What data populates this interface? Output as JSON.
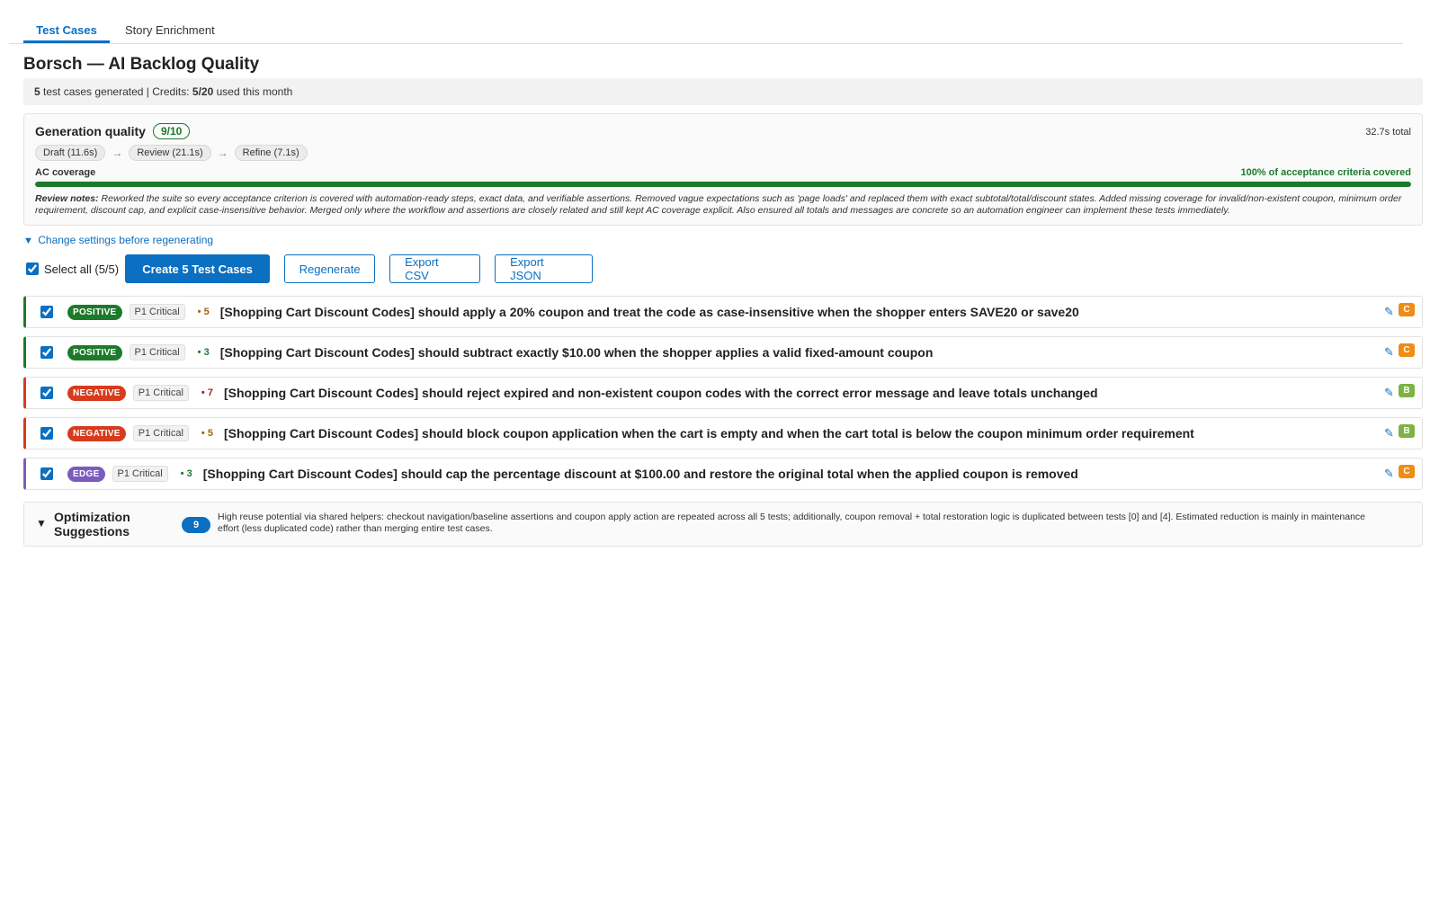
{
  "tabs": [
    {
      "label": "Test Cases",
      "active": true
    },
    {
      "label": "Story Enrichment",
      "active": false
    }
  ],
  "title": "Borsch — AI Backlog Quality",
  "summary": {
    "generated_count": "5",
    "generated_text": "test cases generated | Credits:",
    "credits": "5/20",
    "credits_suffix": "used this month"
  },
  "quality": {
    "label": "Generation quality",
    "score": "9/10",
    "total_time": "32.7s total",
    "stages": [
      "Draft (11.6s)",
      "Review (21.1s)",
      "Refine (7.1s)"
    ],
    "stage_arrow": "→",
    "coverage_label": "AC coverage",
    "coverage_text": "100% of acceptance criteria covered",
    "coverage_fraction": 1.0,
    "notes_label": "Review notes:",
    "notes_text": "Reworked the suite so every acceptance criterion is covered with automation-ready steps, exact data, and verifiable assertions. Removed vague expectations such as 'page loads' and replaced them with exact subtotal/total/discount states. Added missing coverage for invalid/non-existent coupon, minimum order requirement, discount cap, and explicit case-insensitive behavior. Merged only where the workflow and assertions are closely related and still kept AC coverage explicit. Also ensured all totals and messages are concrete so an automation engineer can implement these tests immediately."
  },
  "change_settings": {
    "icon": "▼",
    "label": "Change settings before regenerating"
  },
  "toolbar": {
    "select_all_label": "Select all (5/5)",
    "create_label": "Create 5 Test Cases",
    "regenerate_label": "Regenerate",
    "export_csv_label": "Export CSV",
    "export_json_label": "Export JSON"
  },
  "cases": [
    {
      "type": "POSITIVE",
      "priority": "P1 Critical",
      "steps": "• 5",
      "title": "[Shopping Cart Discount Codes] should apply a 20% coupon and treat the code as case-insensitive when the shopper enters SAVE20 or save20",
      "grade": "C"
    },
    {
      "type": "POSITIVE",
      "priority": "P1 Critical",
      "steps": "• 3",
      "title": "[Shopping Cart Discount Codes] should subtract exactly $10.00 when the shopper applies a valid fixed-amount coupon",
      "grade": "C"
    },
    {
      "type": "NEGATIVE",
      "priority": "P1 Critical",
      "steps": "• 7",
      "title": "[Shopping Cart Discount Codes] should reject expired and non-existent coupon codes with the correct error message and leave totals unchanged",
      "grade": "B"
    },
    {
      "type": "NEGATIVE",
      "priority": "P1 Critical",
      "steps": "• 5",
      "title": "[Shopping Cart Discount Codes] should block coupon application when the cart is empty and when the cart total is below the coupon minimum order requirement",
      "grade": "B"
    },
    {
      "type": "EDGE",
      "priority": "P1 Critical",
      "steps": "• 3",
      "title": "[Shopping Cart Discount Codes] should cap the percentage discount at $100.00 and restore the original total when the applied coupon is removed",
      "grade": "C"
    }
  ],
  "edit_icon": "✎",
  "optimization": {
    "icon": "▼",
    "title": "Optimization Suggestions",
    "count": "9",
    "text": "High reuse potential via shared helpers: checkout navigation/baseline assertions and coupon apply action are repeated across all 5 tests; additionally, coupon removal + total restoration logic is duplicated between tests [0] and [4]. Estimated reduction is mainly in maintenance effort (less duplicated code) rather than merging entire test cases."
  },
  "colors": {
    "accent": "#0b6fc2",
    "positive": "#1d7a2b",
    "negative": "#d63b1e",
    "edge": "#7b5bbd",
    "grade_c": "#ee8c14",
    "grade_b": "#7cb342"
  }
}
